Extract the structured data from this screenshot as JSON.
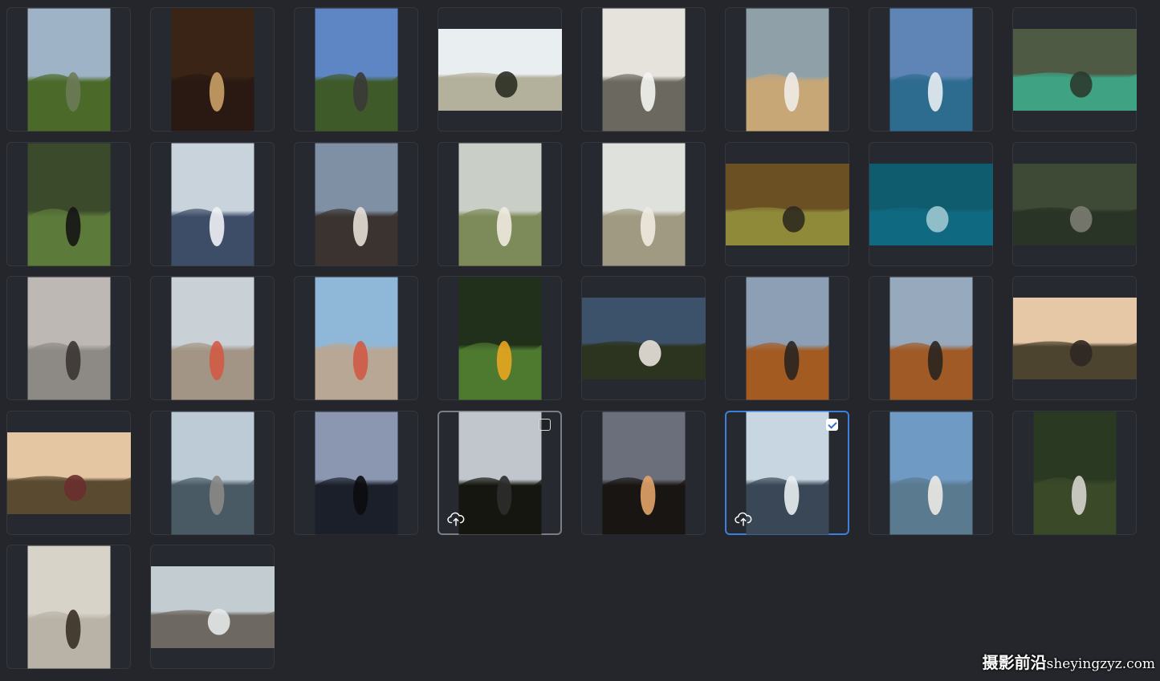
{
  "photos": [
    {
      "name": "mountain-bay-photo",
      "shape": "portrait",
      "sky": "#9fb3c6",
      "ground": "#4b6a2a",
      "accent": "#6c7b56"
    },
    {
      "name": "jungle-lodge-photo",
      "shape": "portrait",
      "sky": "#3a2416",
      "ground": "#2a1a12",
      "accent": "#c9a067"
    },
    {
      "name": "elephant-photo",
      "shape": "portrait",
      "sky": "#5f86c4",
      "ground": "#3f5a2a",
      "accent": "#3a3a36"
    },
    {
      "name": "wedding-car-photo",
      "shape": "landscape",
      "sky": "#e9eef0",
      "ground": "#b3b09c",
      "accent": "#2a2d22"
    },
    {
      "name": "bride-veil-photo",
      "shape": "portrait",
      "sky": "#e6e2dc",
      "ground": "#6b6a60",
      "accent": "#f4f4f2"
    },
    {
      "name": "beach-girl-photo",
      "shape": "portrait",
      "sky": "#8fa0a8",
      "ground": "#c8a777",
      "accent": "#f0ece6"
    },
    {
      "name": "boat-wake-photo",
      "shape": "portrait",
      "sky": "#5e85b5",
      "ground": "#2e6b8f",
      "accent": "#e8eef2"
    },
    {
      "name": "aerial-coast-photo",
      "shape": "landscape",
      "sky": "#4f5a44",
      "ground": "#3fa283",
      "accent": "#2b3a2e"
    },
    {
      "name": "puffin-photo",
      "shape": "portrait",
      "sky": "#3c4a2c",
      "ground": "#5d7a3b",
      "accent": "#151515"
    },
    {
      "name": "snow-mountain-photo",
      "shape": "portrait",
      "sky": "#c9d3dc",
      "ground": "#3d4d68",
      "accent": "#eef2f5"
    },
    {
      "name": "surf-girl-photo",
      "shape": "portrait",
      "sky": "#7f8fa4",
      "ground": "#3b3330",
      "accent": "#e6ded7"
    },
    {
      "name": "lake-boat-photo",
      "shape": "portrait",
      "sky": "#c9cfc6",
      "ground": "#7d8a5a",
      "accent": "#efeae0"
    },
    {
      "name": "lake-boat-2-photo",
      "shape": "portrait",
      "sky": "#dfe1dc",
      "ground": "#a09a82",
      "accent": "#efeae0"
    },
    {
      "name": "bear-field-photo",
      "shape": "landscape",
      "sky": "#6b5024",
      "ground": "#8f8a3a",
      "accent": "#2f2a20"
    },
    {
      "name": "ocean-aerial-photo",
      "shape": "landscape",
      "sky": "#0f5c6e",
      "ground": "#106a80",
      "accent": "#9fc8cf"
    },
    {
      "name": "forest-road-photo",
      "shape": "landscape",
      "sky": "#3f4a36",
      "ground": "#2a3326",
      "accent": "#7c7c72"
    },
    {
      "name": "misty-sea-photo",
      "shape": "portrait",
      "sky": "#bdb8b3",
      "ground": "#8d8985",
      "accent": "#3a3533"
    },
    {
      "name": "barcelona-street-photo",
      "shape": "portrait",
      "sky": "#c9d0d6",
      "ground": "#a39585",
      "accent": "#d05a45"
    },
    {
      "name": "barcelona-street-2-photo",
      "shape": "portrait",
      "sky": "#8fb7d8",
      "ground": "#b8a794",
      "accent": "#d05a45"
    },
    {
      "name": "picnic-photo",
      "shape": "portrait",
      "sky": "#21301a",
      "ground": "#4f7a30",
      "accent": "#e9a521"
    },
    {
      "name": "grass-dress-photo",
      "shape": "landscape",
      "sky": "#3c526a",
      "ground": "#2c3320",
      "accent": "#e8e2da"
    },
    {
      "name": "tuscany-wall-photo",
      "shape": "portrait",
      "sky": "#8c9fb4",
      "ground": "#a45b22",
      "accent": "#2a2420"
    },
    {
      "name": "tuscany-wall-2-photo",
      "shape": "portrait",
      "sky": "#97a9bd",
      "ground": "#a05a26",
      "accent": "#2a2420"
    },
    {
      "name": "tuscany-hills-photo",
      "shape": "landscape",
      "sky": "#e6c7a6",
      "ground": "#4d4530",
      "accent": "#2f2722"
    },
    {
      "name": "tuscany-camera-photo",
      "shape": "landscape",
      "sky": "#e4c6a3",
      "ground": "#5a4c30",
      "accent": "#6a2f2f"
    },
    {
      "name": "lake-rocks-photo",
      "shape": "portrait",
      "sky": "#bccbd6",
      "ground": "#4a5a64",
      "accent": "#8b8a86"
    },
    {
      "name": "silhouette-lake-photo",
      "shape": "portrait",
      "sky": "#8b96b0",
      "ground": "#1b1f2a",
      "accent": "#0c0c10"
    },
    {
      "name": "mountain-reflection-photo",
      "shape": "portrait",
      "sky": "#c0c6cc",
      "ground": "#15170f",
      "accent": "#2c2e2c"
    },
    {
      "name": "sunset-gazebo-photo",
      "shape": "portrait",
      "sky": "#6b6f7c",
      "ground": "#1a1613",
      "accent": "#e3a36a"
    },
    {
      "name": "snowy-forest-photo",
      "shape": "portrait",
      "sky": "#c7d6e0",
      "ground": "#394757",
      "accent": "#e9eef2"
    },
    {
      "name": "sea-woman-photo",
      "shape": "portrait",
      "sky": "#6f9ac4",
      "ground": "#5a7a90",
      "accent": "#eceae6"
    },
    {
      "name": "hammock-photo",
      "shape": "portrait",
      "sky": "#2a3a22",
      "ground": "#3b4a2a",
      "accent": "#d6d3ce"
    },
    {
      "name": "book-guide-photo",
      "shape": "portrait",
      "sky": "#d8d3c9",
      "ground": "#b9b2a6",
      "accent": "#3a3026"
    },
    {
      "name": "waterfall-canyon-photo",
      "shape": "landscape",
      "sky": "#c3ccd1",
      "ground": "#6d6a62",
      "accent": "#e6e9ea"
    }
  ],
  "watermark": {
    "cn": "摄影前沿",
    "en": "sheyingzyz.com"
  }
}
